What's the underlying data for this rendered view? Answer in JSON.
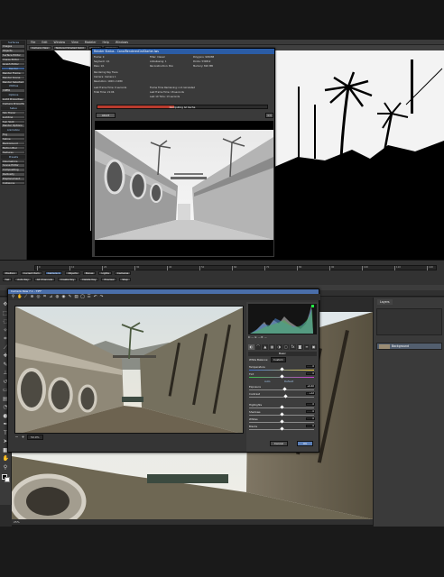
{
  "top_app": {
    "menu": [
      "File",
      "Edit",
      "Window",
      "View",
      "Modeler",
      "Help",
      "Windows"
    ],
    "left_buttons": [
      "Surfaces",
      "Images",
      "Objects",
      "Surface Editor",
      "Image Editor",
      "Graph Editor",
      "Render",
      "Render Frame",
      "Render Scene",
      "Render Selected",
      "Utilities",
      "VIPER",
      "Options",
      "Light Properties",
      "Camera Properties",
      "Setup",
      "Sky Tracer",
      "Lighting",
      "Sun Spot",
      "Render Options",
      "Animation",
      "Fog",
      "Spline",
      "Background",
      "Motion Blur",
      "Textures",
      "Presets",
      "Volumetrics",
      "Scene Editor",
      "Compositing",
      "Radiosity",
      "Displacement",
      "Collisions"
    ],
    "viewport_fields": [
      "Camera View",
      "Textured Shaded Solid",
      "(none)",
      "Camera"
    ],
    "timeline_fields": [
      "Position",
      "Current Item",
      "Camera 1",
      "Objects",
      "Bones",
      "Lights",
      "Cameras",
      "Sel",
      "Auto Key",
      "All Channels",
      "Create Key",
      "Delete Key",
      "Preview",
      "Step"
    ],
    "ruler_ticks": [
      "0",
      "10",
      "20",
      "30",
      "40",
      "50",
      "60",
      "70",
      "80",
      "90",
      "100",
      "110",
      "120"
    ]
  },
  "render_status": {
    "title": "Render Status - CanalRendered1stStarter.lws",
    "stats": [
      "Frame: 0",
      "Segment: 1/1",
      "Pass: 1/1",
      "Rendering Ray Trace",
      "Camera: Camera 1",
      "Resolution: 1920 x 1080",
      "Last Frame Time: 0 seconds",
      "Total Time: 21:06",
      "Polygons: 929088",
      "Points: 530812",
      "Memory: 820 MB",
      "Filter: Classic",
      "Antialiasing: 1",
      "Reconstruction: Box",
      "Frame Time Remaining: not calculated",
      "Last Frame Time: 18 seconds",
      "Last 10 Time: 13 seconds"
    ],
    "progress_label": "Computing GI Cache",
    "progress": 0.45,
    "abort_label": "Abort",
    "zoom_label": "1:1"
  },
  "photoshop": {
    "tools": [
      "move-icon",
      "marquee-icon",
      "lasso-icon",
      "wand-icon",
      "crop-icon",
      "eyedropper-icon",
      "healing-icon",
      "brush-icon",
      "stamp-icon",
      "history-icon",
      "eraser-icon",
      "gradient-icon",
      "blur-icon",
      "dodge-icon",
      "pen-icon",
      "type-icon",
      "path-icon",
      "shape-icon",
      "hand-icon",
      "zoom-icon"
    ],
    "status_text": "25%",
    "panel_tabs": [
      "Layers",
      "Channels",
      "Paths"
    ],
    "layer_name": "Background"
  },
  "camera_raw": {
    "title": "Camera Raw 7.1 - TIFF",
    "zoom_value": "50.9%",
    "info": [
      "R: ---",
      "G: ---",
      "B: ---"
    ],
    "section_title": "Basic",
    "white_balance_label": "White Balance:",
    "white_balance_value": "Custom",
    "auto_label": "Auto",
    "default_label": "Default",
    "sliders": [
      {
        "label": "Temperature",
        "value": "0",
        "pos": 0.5,
        "track": "temp"
      },
      {
        "label": "Tint",
        "value": "0",
        "pos": 0.5,
        "track": "tint"
      },
      {
        "label": "Exposure",
        "value": "+0.40",
        "pos": 0.55,
        "track": "gray"
      },
      {
        "label": "Contrast",
        "value": "+12",
        "pos": 0.56,
        "track": "gray"
      },
      {
        "label": "Highlights",
        "value": "0",
        "pos": 0.5,
        "track": "gray"
      },
      {
        "label": "Shadows",
        "value": "0",
        "pos": 0.5,
        "track": "gray"
      },
      {
        "label": "Whites",
        "value": "0",
        "pos": 0.5,
        "track": "gray"
      },
      {
        "label": "Blacks",
        "value": "0",
        "pos": 0.5,
        "track": "gray"
      }
    ],
    "cancel_label": "Cancel",
    "ok_label": "OK"
  }
}
